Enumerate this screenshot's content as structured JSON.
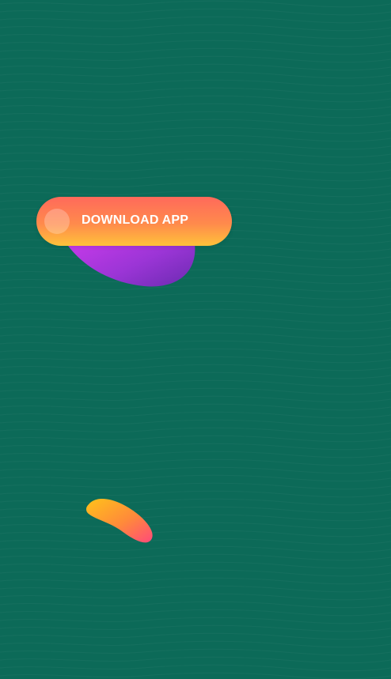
{
  "cta": {
    "download_label": "DOWNLOAD APP"
  },
  "colors": {
    "background": "#0c6a58",
    "button_top": "#ff6a5b",
    "button_bottom": "#ffc23a",
    "blob_purple": "#c23fe6",
    "blob_orange": "#ffb020"
  }
}
